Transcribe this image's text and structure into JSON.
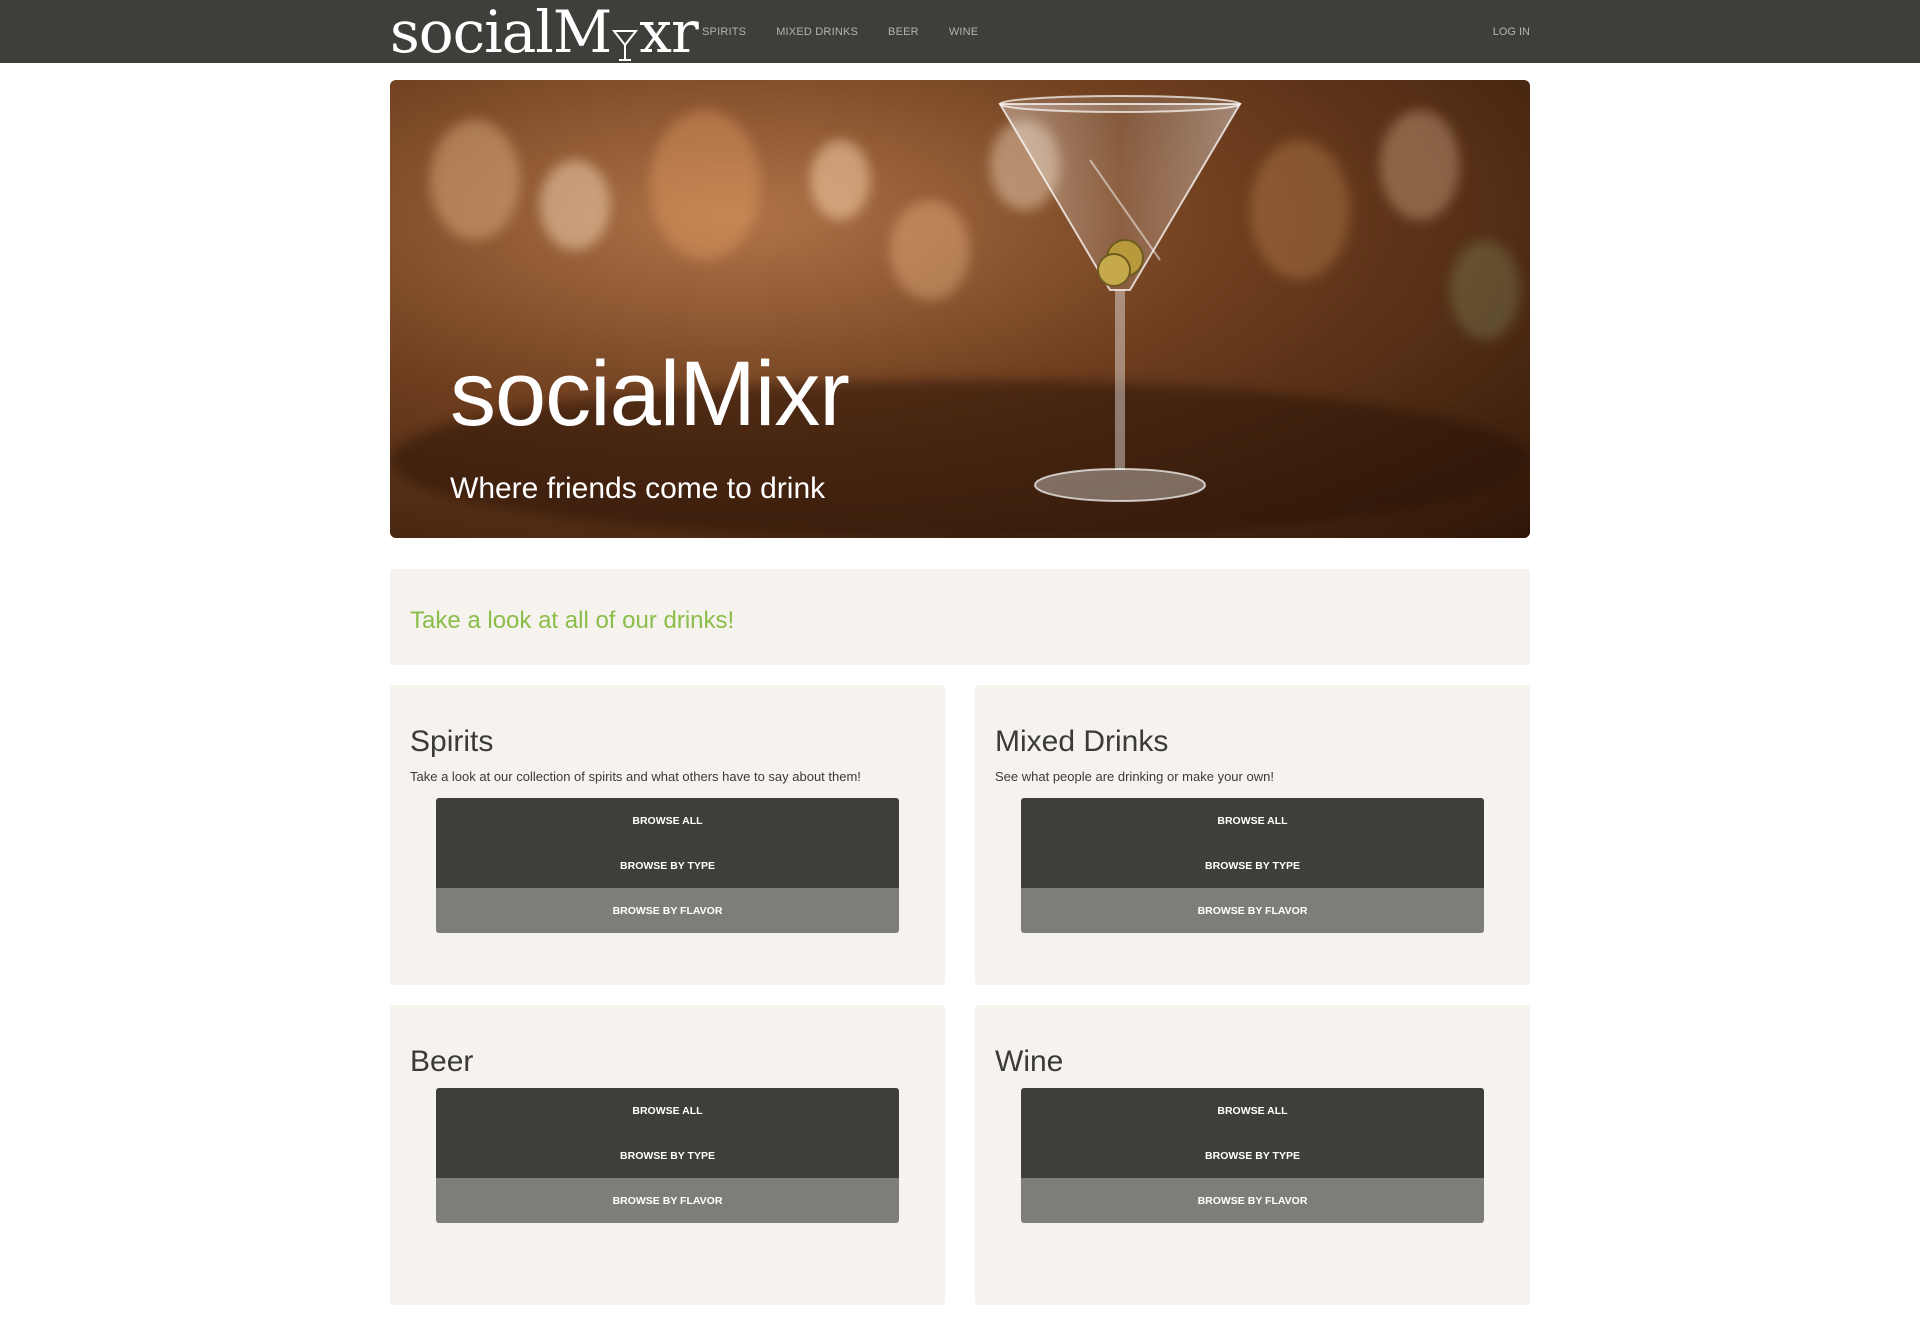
{
  "navbar": {
    "brand": "socialMixr",
    "links": [
      "SPIRITS",
      "MIXED DRINKS",
      "BEER",
      "WINE"
    ],
    "login": "LOG IN",
    "bg_color": "#3e3e3a"
  },
  "hero": {
    "title": "socialMixr",
    "subtitle": "Where friends come to drink"
  },
  "intro": {
    "text": "Take a look at all of our drinks!",
    "accent_color": "#8bbd49"
  },
  "cards": [
    {
      "title": "Spirits",
      "description": "Take a look at our collection of spirits and what others have to say about them!",
      "buttons": [
        "BROWSE ALL",
        "BROWSE BY TYPE",
        "BROWSE BY FLAVOR"
      ]
    },
    {
      "title": "Mixed Drinks",
      "description": "See what people are drinking or make your own!",
      "buttons": [
        "BROWSE ALL",
        "BROWSE BY TYPE",
        "BROWSE BY FLAVOR"
      ]
    },
    {
      "title": "Beer",
      "description": "",
      "buttons": [
        "BROWSE ALL",
        "BROWSE BY TYPE",
        "BROWSE BY FLAVOR"
      ]
    },
    {
      "title": "Wine",
      "description": "",
      "buttons": [
        "BROWSE ALL",
        "BROWSE BY TYPE",
        "BROWSE BY FLAVOR"
      ]
    }
  ]
}
